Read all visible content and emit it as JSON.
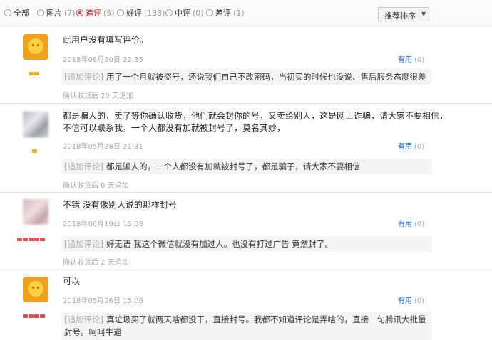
{
  "filters": [
    {
      "label": "全部",
      "count": "",
      "checked": false
    },
    {
      "label": "图片",
      "count": "(7)",
      "checked": false
    },
    {
      "label": "追评",
      "count": "(5)",
      "checked": true
    },
    {
      "label": "好评",
      "count": "(133)",
      "checked": false
    },
    {
      "label": "中评",
      "count": "(0)",
      "checked": false
    },
    {
      "label": "差评",
      "count": "(1)",
      "checked": false
    }
  ],
  "sort": {
    "label": "推荐排序",
    "caret": "▼"
  },
  "reviews": [
    {
      "avatar": "cartoon-flame-avatar",
      "text": "此用户没有填写评价。",
      "date": "2018年06月30日 22:35",
      "useful_label": "有用",
      "useful_count": "(0)",
      "append_tag": "[追加评论]",
      "append_text": "用了一个月就被盗号，还说我们自己不改密码，当初买的时候也没说、售后服务态度很差",
      "append_note": "确认收货后 20 天追加"
    },
    {
      "avatar": "blurred-avatar",
      "text1": "都是骗人的，卖了等你确认收货，他们就会封你的号，又卖给别人，这是网上诈骗，请大家不要相信，",
      "text2": "不信可以联系我，一个人都没有加就被封号了，莫名其妙，",
      "date": "2018年05月28日 21:31",
      "useful_label": "有用",
      "useful_count": "(0)",
      "append_tag": "[追加评论]",
      "append_text": "都是骗人的，一个人都没有加就被封号了，都是骗子，请大家不要相信",
      "append_note": "确认收货后 0 天追加"
    },
    {
      "avatar": "blurred-avatar",
      "text": "不错 没有像别人说的那样封号",
      "date": "2018年06月19日 15:08",
      "useful_label": "有用",
      "useful_count": "(0)",
      "append_tag": "[追加评论]",
      "append_text": "好无语 我这个微信就没有加过人。也没有打过广告 竟然封了。",
      "append_note": "确认收货后 2 天追加"
    },
    {
      "avatar": "cartoon-flame-avatar",
      "text": "可以",
      "date": "2018年05月26日 15:06",
      "useful_label": "有用",
      "useful_count": "(0)",
      "append_tag": "[追加评论]",
      "append_text1": "真垃圾买了就两天啥都没干，直接封号。我都不知道评论是弄啥的，直接一句腾讯大批量",
      "append_text2": "封号。呵呵牛逼"
    }
  ]
}
